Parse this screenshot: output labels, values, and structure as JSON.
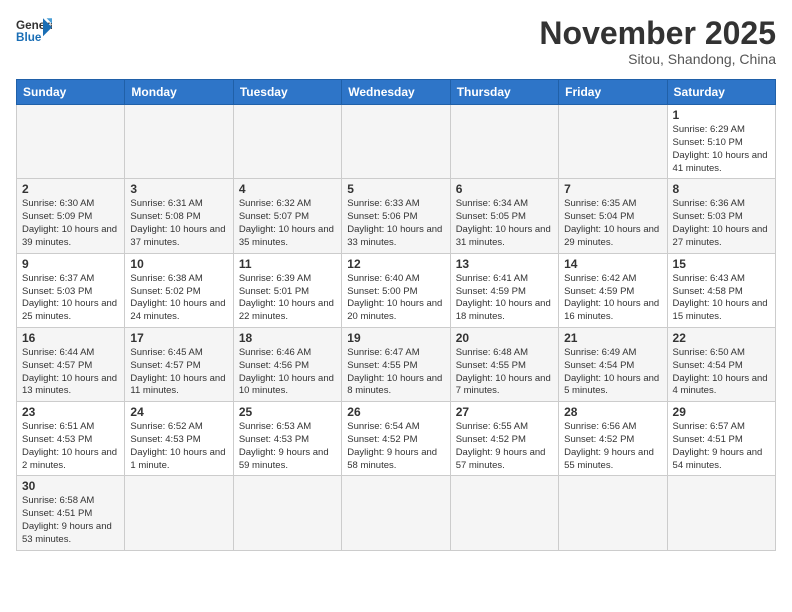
{
  "header": {
    "logo_general": "General",
    "logo_blue": "Blue",
    "month_title": "November 2025",
    "location": "Sitou, Shandong, China"
  },
  "days_of_week": [
    "Sunday",
    "Monday",
    "Tuesday",
    "Wednesday",
    "Thursday",
    "Friday",
    "Saturday"
  ],
  "weeks": [
    {
      "row_bg": "#fff",
      "days": [
        {
          "num": "",
          "info": ""
        },
        {
          "num": "",
          "info": ""
        },
        {
          "num": "",
          "info": ""
        },
        {
          "num": "",
          "info": ""
        },
        {
          "num": "",
          "info": ""
        },
        {
          "num": "",
          "info": ""
        },
        {
          "num": "1",
          "info": "Sunrise: 6:29 AM\nSunset: 5:10 PM\nDaylight: 10 hours\nand 41 minutes."
        }
      ]
    },
    {
      "row_bg": "#f5f5f5",
      "days": [
        {
          "num": "2",
          "info": "Sunrise: 6:30 AM\nSunset: 5:09 PM\nDaylight: 10 hours\nand 39 minutes."
        },
        {
          "num": "3",
          "info": "Sunrise: 6:31 AM\nSunset: 5:08 PM\nDaylight: 10 hours\nand 37 minutes."
        },
        {
          "num": "4",
          "info": "Sunrise: 6:32 AM\nSunset: 5:07 PM\nDaylight: 10 hours\nand 35 minutes."
        },
        {
          "num": "5",
          "info": "Sunrise: 6:33 AM\nSunset: 5:06 PM\nDaylight: 10 hours\nand 33 minutes."
        },
        {
          "num": "6",
          "info": "Sunrise: 6:34 AM\nSunset: 5:05 PM\nDaylight: 10 hours\nand 31 minutes."
        },
        {
          "num": "7",
          "info": "Sunrise: 6:35 AM\nSunset: 5:04 PM\nDaylight: 10 hours\nand 29 minutes."
        },
        {
          "num": "8",
          "info": "Sunrise: 6:36 AM\nSunset: 5:03 PM\nDaylight: 10 hours\nand 27 minutes."
        }
      ]
    },
    {
      "row_bg": "#fff",
      "days": [
        {
          "num": "9",
          "info": "Sunrise: 6:37 AM\nSunset: 5:03 PM\nDaylight: 10 hours\nand 25 minutes."
        },
        {
          "num": "10",
          "info": "Sunrise: 6:38 AM\nSunset: 5:02 PM\nDaylight: 10 hours\nand 24 minutes."
        },
        {
          "num": "11",
          "info": "Sunrise: 6:39 AM\nSunset: 5:01 PM\nDaylight: 10 hours\nand 22 minutes."
        },
        {
          "num": "12",
          "info": "Sunrise: 6:40 AM\nSunset: 5:00 PM\nDaylight: 10 hours\nand 20 minutes."
        },
        {
          "num": "13",
          "info": "Sunrise: 6:41 AM\nSunset: 4:59 PM\nDaylight: 10 hours\nand 18 minutes."
        },
        {
          "num": "14",
          "info": "Sunrise: 6:42 AM\nSunset: 4:59 PM\nDaylight: 10 hours\nand 16 minutes."
        },
        {
          "num": "15",
          "info": "Sunrise: 6:43 AM\nSunset: 4:58 PM\nDaylight: 10 hours\nand 15 minutes."
        }
      ]
    },
    {
      "row_bg": "#f5f5f5",
      "days": [
        {
          "num": "16",
          "info": "Sunrise: 6:44 AM\nSunset: 4:57 PM\nDaylight: 10 hours\nand 13 minutes."
        },
        {
          "num": "17",
          "info": "Sunrise: 6:45 AM\nSunset: 4:57 PM\nDaylight: 10 hours\nand 11 minutes."
        },
        {
          "num": "18",
          "info": "Sunrise: 6:46 AM\nSunset: 4:56 PM\nDaylight: 10 hours\nand 10 minutes."
        },
        {
          "num": "19",
          "info": "Sunrise: 6:47 AM\nSunset: 4:55 PM\nDaylight: 10 hours\nand 8 minutes."
        },
        {
          "num": "20",
          "info": "Sunrise: 6:48 AM\nSunset: 4:55 PM\nDaylight: 10 hours\nand 7 minutes."
        },
        {
          "num": "21",
          "info": "Sunrise: 6:49 AM\nSunset: 4:54 PM\nDaylight: 10 hours\nand 5 minutes."
        },
        {
          "num": "22",
          "info": "Sunrise: 6:50 AM\nSunset: 4:54 PM\nDaylight: 10 hours\nand 4 minutes."
        }
      ]
    },
    {
      "row_bg": "#fff",
      "days": [
        {
          "num": "23",
          "info": "Sunrise: 6:51 AM\nSunset: 4:53 PM\nDaylight: 10 hours\nand 2 minutes."
        },
        {
          "num": "24",
          "info": "Sunrise: 6:52 AM\nSunset: 4:53 PM\nDaylight: 10 hours\nand 1 minute."
        },
        {
          "num": "25",
          "info": "Sunrise: 6:53 AM\nSunset: 4:53 PM\nDaylight: 9 hours\nand 59 minutes."
        },
        {
          "num": "26",
          "info": "Sunrise: 6:54 AM\nSunset: 4:52 PM\nDaylight: 9 hours\nand 58 minutes."
        },
        {
          "num": "27",
          "info": "Sunrise: 6:55 AM\nSunset: 4:52 PM\nDaylight: 9 hours\nand 57 minutes."
        },
        {
          "num": "28",
          "info": "Sunrise: 6:56 AM\nSunset: 4:52 PM\nDaylight: 9 hours\nand 55 minutes."
        },
        {
          "num": "29",
          "info": "Sunrise: 6:57 AM\nSunset: 4:51 PM\nDaylight: 9 hours\nand 54 minutes."
        }
      ]
    },
    {
      "row_bg": "#f5f5f5",
      "days": [
        {
          "num": "30",
          "info": "Sunrise: 6:58 AM\nSunset: 4:51 PM\nDaylight: 9 hours\nand 53 minutes."
        },
        {
          "num": "",
          "info": ""
        },
        {
          "num": "",
          "info": ""
        },
        {
          "num": "",
          "info": ""
        },
        {
          "num": "",
          "info": ""
        },
        {
          "num": "",
          "info": ""
        },
        {
          "num": "",
          "info": ""
        }
      ]
    }
  ]
}
